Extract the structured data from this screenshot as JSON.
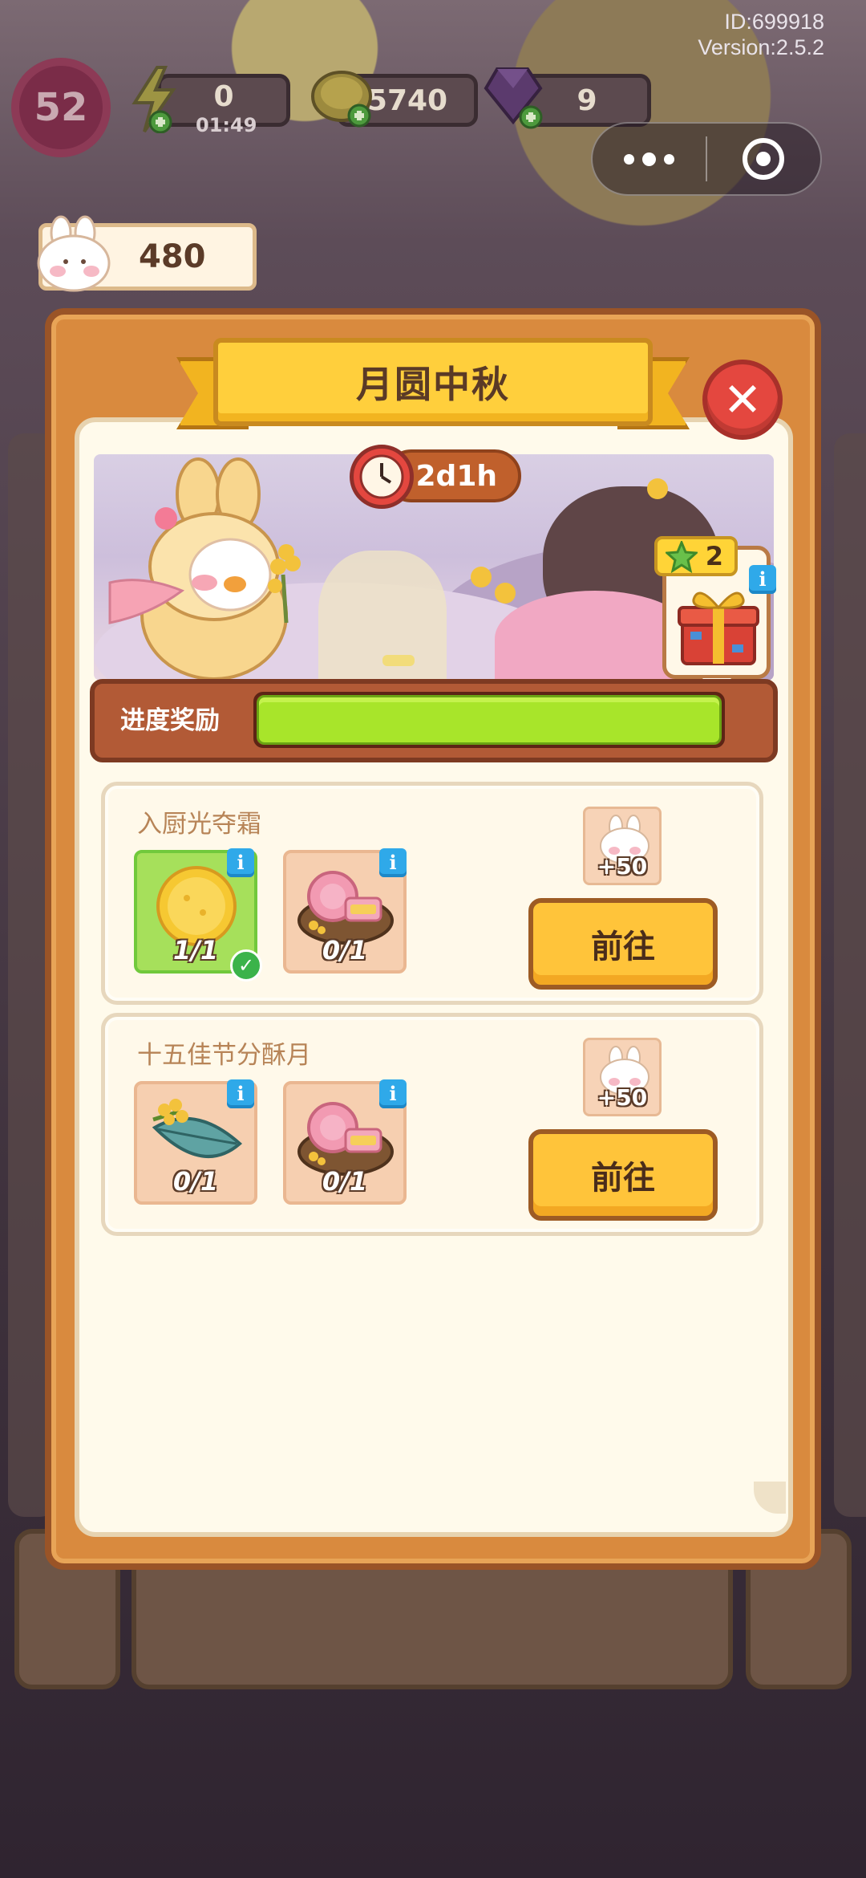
{
  "hud": {
    "user_id": "ID:699918",
    "version": "Version:2.5.2",
    "level": "52",
    "energy_value": "0",
    "energy_timer": "01:49",
    "coins": "5740",
    "gems": "9",
    "bunny_count": "480"
  },
  "event": {
    "title": "月圆中秋",
    "timer": "2d1h",
    "reward_stars": "2",
    "progress_label": "进度奖励",
    "progress_fraction": 1.0
  },
  "tasks": [
    {
      "title": "入厨光夺霜",
      "items": [
        {
          "icon": "golden-mooncake-icon",
          "count": "1/1",
          "done": true
        },
        {
          "icon": "rose-mooncake-plate-icon",
          "count": "0/1",
          "done": false
        }
      ],
      "reward": "+50",
      "button": "前往"
    },
    {
      "title": "十五佳节分酥月",
      "items": [
        {
          "icon": "osmanthus-leaf-icon",
          "count": "0/1",
          "done": false
        },
        {
          "icon": "rose-mooncake-plate-icon",
          "count": "0/1",
          "done": false
        }
      ],
      "reward": "+50",
      "button": "前往"
    }
  ],
  "colors": {
    "accent_yellow": "#ffc43a",
    "progress_green": "#a8e52a",
    "close_red": "#e4473f",
    "info_blue": "#2fa9e9"
  }
}
